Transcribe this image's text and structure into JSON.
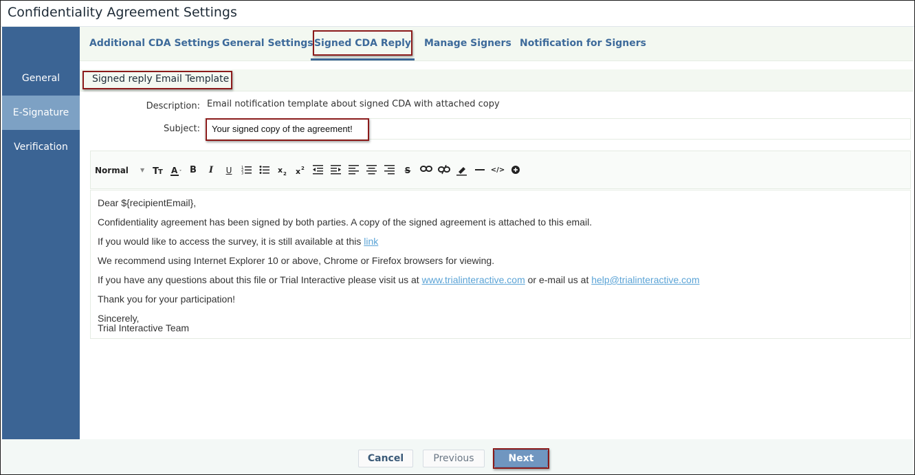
{
  "window": {
    "title": "Confidentiality Agreement Settings"
  },
  "sidebar": {
    "items": [
      {
        "label": "General",
        "active": false
      },
      {
        "label": "E-Signature",
        "active": true
      },
      {
        "label": "Verification",
        "active": false
      }
    ]
  },
  "tabs": [
    {
      "label": "Additional CDA Settings",
      "active": false
    },
    {
      "label": "General Settings",
      "active": false
    },
    {
      "label": "Signed CDA Reply",
      "active": true
    },
    {
      "label": "Manage Signers",
      "active": false
    },
    {
      "label": "Notification for Signers",
      "active": false
    }
  ],
  "section": {
    "title": "Signed reply Email Template"
  },
  "form": {
    "description_label": "Description:",
    "description_value": "Email notification template about signed CDA with attached copy",
    "subject_label": "Subject:",
    "subject_value": "Your signed copy of the agreement!"
  },
  "toolbar": {
    "format_select": "Normal",
    "icons": [
      "text-size-icon",
      "font-color-icon",
      "bold-icon",
      "italic-icon",
      "underline-icon",
      "ordered-list-icon",
      "bullet-list-icon",
      "subscript-icon",
      "superscript-icon",
      "outdent-icon",
      "indent-icon",
      "align-left-icon",
      "align-center-icon",
      "align-right-icon",
      "strikethrough-icon",
      "link-icon",
      "unlink-icon",
      "highlight-icon",
      "horizontal-rule-icon",
      "code-view-icon",
      "more-icon"
    ],
    "bold_glyph": "B",
    "italic_glyph": "I",
    "underline_glyph": "U",
    "strike_glyph": "S",
    "code_glyph": "</>"
  },
  "editor": {
    "greeting": "Dear ${recipientEmail},",
    "line1": "Confidentiality agreement has been signed by both parties. A copy of the signed agreement is attached to this email.",
    "line2_text": "If you would like to access the survey, it is still available at this ",
    "line2_link": "link",
    "line3": "We recommend using Internet Explorer 10 or above, Chrome or Firefox browsers for viewing.",
    "line4_text1": "If you have any questions about this file or Trial Interactive please visit us at ",
    "line4_link1": "www.trialinteractive.com",
    "line4_text2": " or e-mail us at ",
    "line4_link2": "help@trialinteractive.com",
    "line5": "Thank you for your participation!",
    "closing1": "Sincerely,",
    "closing2": "Trial Interactive Team"
  },
  "footer": {
    "cancel": "Cancel",
    "previous": "Previous",
    "next": "Next"
  },
  "colors": {
    "sidebar": "#3b6494",
    "sidebar_active": "#7da1c4",
    "tab_text": "#3d6a9a",
    "highlight_border": "#8b1a1a",
    "link": "#5aa3d6",
    "next_button": "#7096c0"
  }
}
